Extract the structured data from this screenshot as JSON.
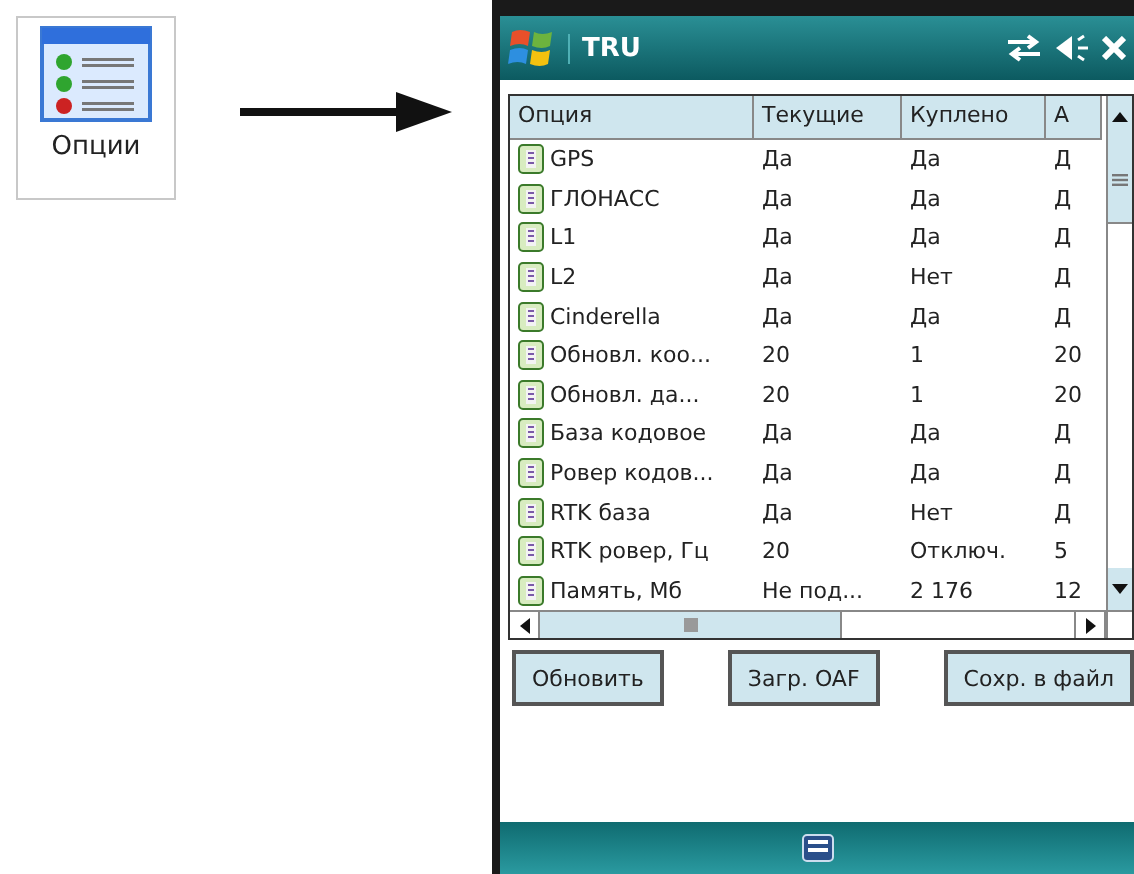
{
  "launcher": {
    "label": "Опции"
  },
  "window": {
    "title": "TRU"
  },
  "table": {
    "columns": [
      "Опция",
      "Текущие",
      "Куплено",
      "А"
    ],
    "rows": [
      {
        "cells": [
          "GPS",
          "Да",
          "Да",
          "Д"
        ]
      },
      {
        "cells": [
          "ГЛОНАСС",
          "Да",
          "Да",
          "Д"
        ]
      },
      {
        "cells": [
          "L1",
          "Да",
          "Да",
          "Д"
        ]
      },
      {
        "cells": [
          "L2",
          "Да",
          "Нет",
          "Д"
        ]
      },
      {
        "cells": [
          "Cinderella",
          "Да",
          "Да",
          "Д"
        ]
      },
      {
        "cells": [
          "Обновл. коо...",
          "20",
          "1",
          "20"
        ]
      },
      {
        "cells": [
          "Обновл. да...",
          "20",
          "1",
          "20"
        ]
      },
      {
        "cells": [
          "База кодовое",
          "Да",
          "Да",
          "Д"
        ]
      },
      {
        "cells": [
          "Ровер кодов...",
          "Да",
          "Да",
          "Д"
        ]
      },
      {
        "cells": [
          "RTK база",
          "Да",
          "Нет",
          "Д"
        ]
      },
      {
        "cells": [
          "RTK ровер, Гц",
          "20",
          "Отключ.",
          "5"
        ]
      },
      {
        "cells": [
          "Память, Мб",
          "Не под...",
          "2 176",
          "12"
        ]
      }
    ]
  },
  "buttons": [
    "Обновить",
    "Загр. OAF",
    "Сохр. в файл"
  ]
}
